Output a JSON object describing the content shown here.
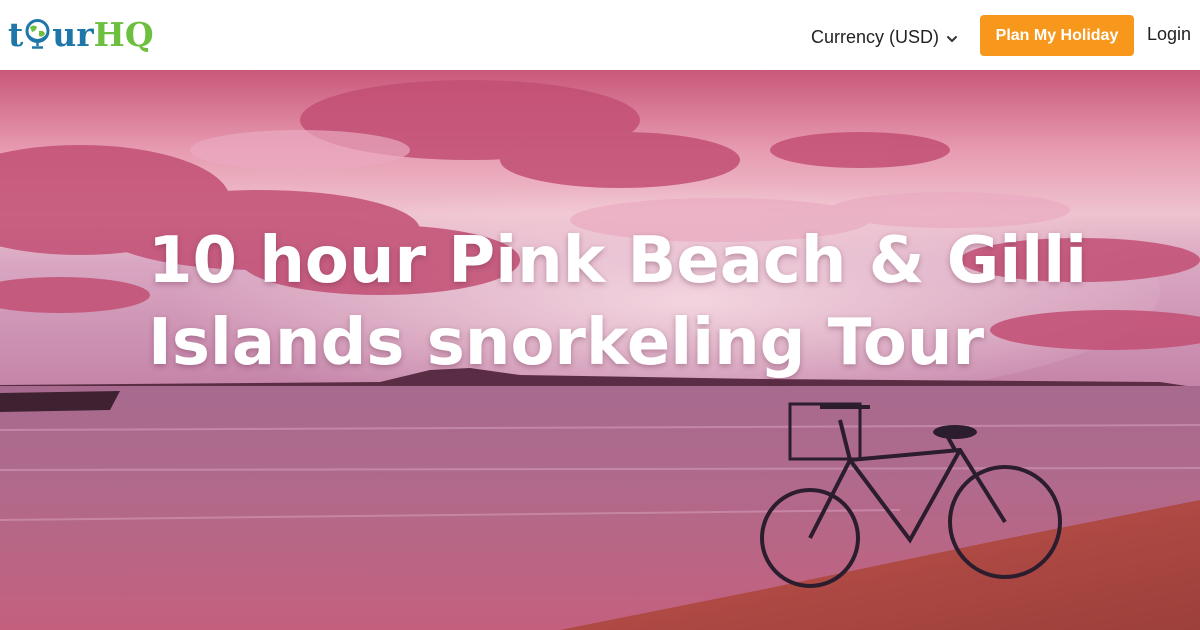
{
  "header": {
    "logo": {
      "part1": "t",
      "part2": "ur",
      "part3": "HQ",
      "icon": "globe-icon"
    },
    "currency_label": "Currency (USD)",
    "currency_icon": "chevron-down-icon",
    "plan_button": "Plan My Holiday",
    "login": "Login"
  },
  "hero": {
    "title": "10 hour Pink Beach & Gilli Islands snorkeling Tour",
    "image": "beach-sunset-bicycle-image"
  },
  "colors": {
    "logo_blue": "#1f76a8",
    "logo_green": "#6cbf3f",
    "accent_orange": "#f7981d",
    "hero_pink": "#d0607f"
  }
}
